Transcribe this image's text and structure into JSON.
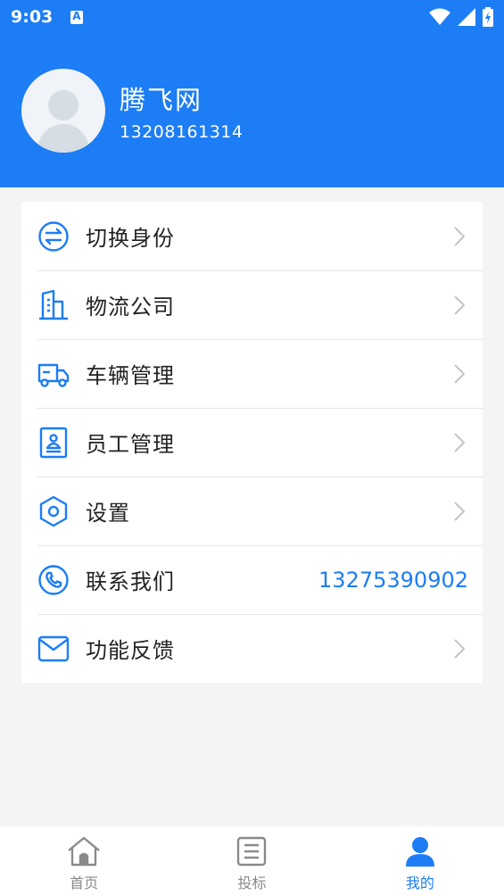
{
  "status": {
    "time": "9:03"
  },
  "profile": {
    "name": "腾飞网",
    "phone": "13208161314"
  },
  "menu": [
    {
      "label": "切换身份",
      "icon": "switch-icon"
    },
    {
      "label": "物流公司",
      "icon": "building-icon"
    },
    {
      "label": "车辆管理",
      "icon": "truck-icon"
    },
    {
      "label": "员工管理",
      "icon": "id-card-icon"
    },
    {
      "label": "设置",
      "icon": "hex-settings-icon"
    },
    {
      "label": "联系我们",
      "icon": "phone-icon",
      "value": "13275390902"
    },
    {
      "label": "功能反馈",
      "icon": "mail-icon"
    }
  ],
  "tabs": [
    {
      "label": "首页",
      "icon": "home-icon"
    },
    {
      "label": "投标",
      "icon": "document-icon"
    },
    {
      "label": "我的",
      "icon": "user-icon",
      "active": true
    }
  ],
  "colors": {
    "accent": "#1c7df5",
    "background": "#f4f4f4"
  }
}
